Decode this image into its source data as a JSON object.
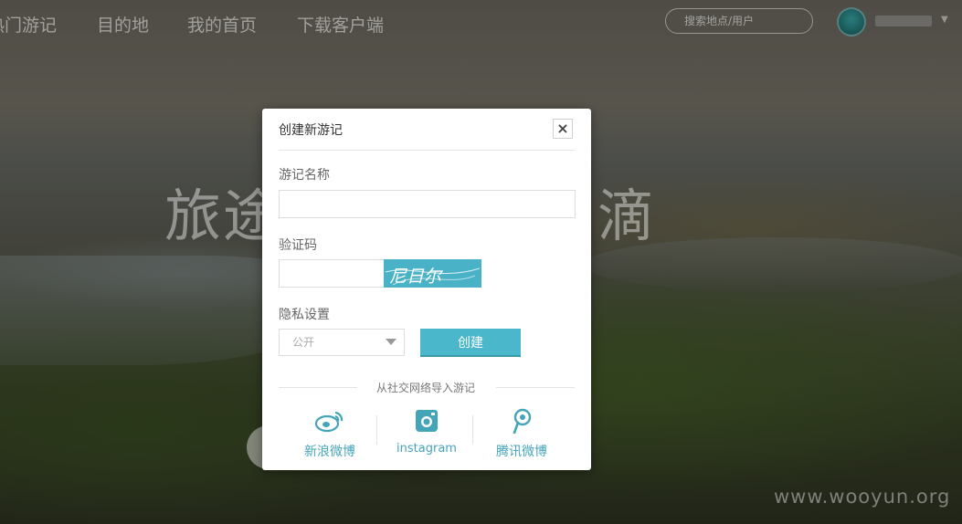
{
  "nav": {
    "items": [
      "热门游记",
      "目的地",
      "我的首页",
      "下载客户端"
    ],
    "search_placeholder": "搜索地点/用户"
  },
  "hero": {
    "title_left": "旅途",
    "title_right": "滴"
  },
  "watermark": "www.wooyun.org",
  "modal": {
    "title": "创建新游记",
    "close": "×",
    "name_label": "游记名称",
    "name_value": "",
    "captcha_label": "验证码",
    "captcha_value": "",
    "captcha_text": "尼日尔",
    "privacy_label": "隐私设置",
    "privacy_value": "公开",
    "create_button": "创建",
    "import_label": "从社交网络导入游记",
    "social": [
      {
        "label": "新浪微博",
        "icon": "weibo-icon"
      },
      {
        "label": "instagram",
        "icon": "instagram-icon"
      },
      {
        "label": "腾讯微博",
        "icon": "tencent-weibo-icon"
      }
    ]
  },
  "colors": {
    "accent": "#4ab8ca",
    "link": "#45a5b8"
  }
}
